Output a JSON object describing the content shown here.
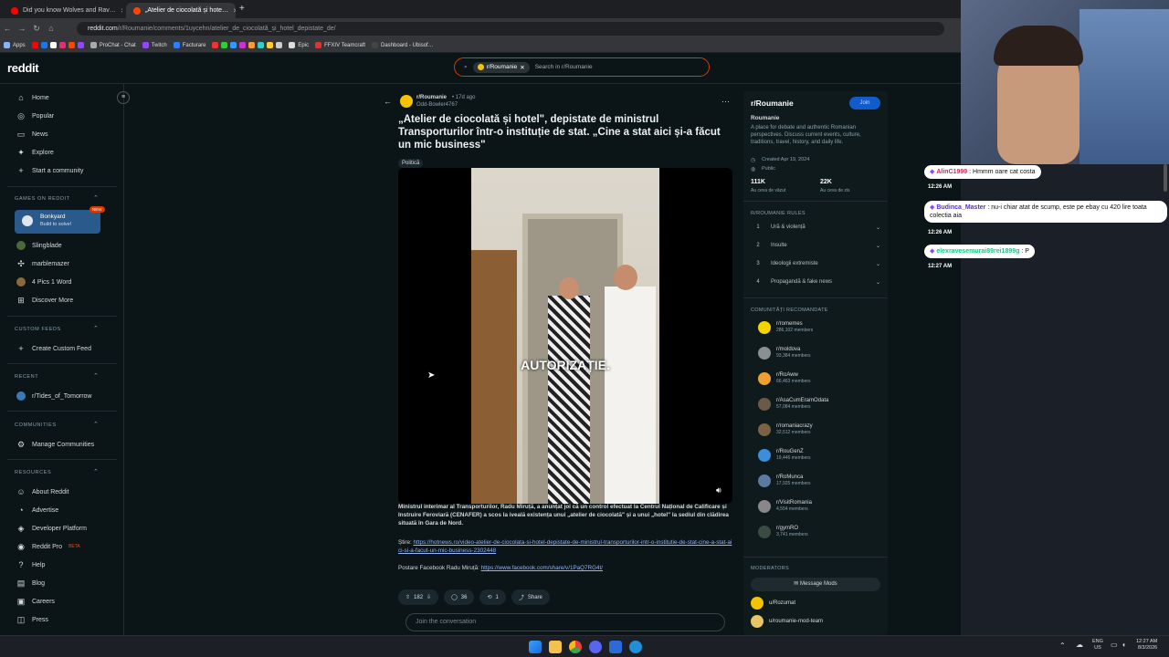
{
  "browser": {
    "tabs": [
      {
        "title": "Did you know Wolves and Rav…",
        "favicon_color": "#ff0000"
      },
      {
        "title": "„Atelier de ciocolată și hote…",
        "favicon_color": "#ff4500"
      }
    ],
    "url_host": "reddit.com",
    "url_path": "/r/Roumanie/comments/1uycehn/atelier_de_ciocolată_și_hotel_depistate_de/",
    "bookmarks": [
      "Apps",
      "ProChat - Chat",
      "Twitch",
      "Facturare",
      "Epic",
      "FFXIV Teamcraft",
      "Dashboard - Ubisof…"
    ]
  },
  "reddit": {
    "logo": "reddit",
    "search": {
      "chip": "r/Roumanie",
      "placeholder": "Search in r/Roumanie"
    }
  },
  "leftnav": {
    "main": [
      "Home",
      "Popular",
      "News",
      "Explore",
      "Start a community"
    ],
    "games_title": "GAMES ON REDDIT",
    "bonkyard": {
      "name": "Bonkyard",
      "sub": "Build to solve!",
      "badge": "NEW"
    },
    "games": [
      "Slingblade",
      "marblemazer",
      "4 Pics 1 Word",
      "Discover More"
    ],
    "custom_title": "CUSTOM FEEDS",
    "custom": [
      "Create Custom Feed"
    ],
    "recent_title": "RECENT",
    "recent": [
      "r/Tides_of_Tomorrow"
    ],
    "communities_title": "COMMUNITIES",
    "communities": [
      "Manage Communities"
    ],
    "resources_title": "RESOURCES",
    "resources": [
      "About Reddit",
      "Advertise",
      "Developer Platform",
      "Reddit Pro",
      "Help",
      "Blog",
      "Careers",
      "Press"
    ],
    "beta": "BETA"
  },
  "post": {
    "subreddit": "r/Roumanie",
    "age": "• 17d ago",
    "author": "Odd-Bowler4767",
    "title": "„Atelier de ciocolată și hotel\", depistate de ministrul Transporturilor într-o instituție de stat. „Cine a stat aici și-a făcut un mic business\"",
    "flair": "Politică",
    "video_caption": "AUTORIZAȚIE.",
    "body": "Ministrul interimar al Transporturilor, Radu Miruță, a anunțat joi că un control efectuat la Centrul Național de Calificare și Instruire Feroviară (CENAFER) a scos la iveală existența unui „atelier de ciocolată\" și a unui „hotel\" la sediul din clădirea situată în Gara de Nord.",
    "stire_label": "Știre:",
    "stire_link": "https://hotnews.ro/video-atelier-de-ciocolata-si-hotel-depistate-de-ministrul-transporturilor-intr-o-institutie-de-stat-cine-a-stat-aici-si-a-facut-un-mic-business-2302448",
    "fb_label": "Postare Facebook Radu Miruță:",
    "fb_link": "https://www.facebook.com/share/v/1PaQ7RG4t/",
    "votes": "182",
    "comments": "36",
    "crossposts": "1",
    "share": "Share",
    "join_placeholder": "Join the conversation"
  },
  "rside": {
    "name": "r/Roumanie",
    "join": "Join",
    "subtitle": "Roumanie",
    "desc": "A place for debate and authentic Romanian perspectives. Discuss current events, culture, traditions, travel, history, and daily life.",
    "created": "Created Apr 19, 2024",
    "visibility": "Public",
    "weekly_visitors": "111K",
    "weekly_visitors_label": "Au ceva de văzut",
    "weekly_contrib": "22K",
    "weekly_contrib_label": "Au ceva de zis",
    "rules_title": "R/ROUMANIE RULES",
    "rules": [
      {
        "n": "1",
        "t": "Ură & violență"
      },
      {
        "n": "2",
        "t": "Insulte"
      },
      {
        "n": "3",
        "t": "Ideologii extremiste"
      },
      {
        "n": "4",
        "t": "Propagandă & fake news"
      }
    ],
    "recommended_title": "COMUNITĂȚI RECOMANDATE",
    "recommended": [
      {
        "name": "r/romemes",
        "members": "286,102 members",
        "color": "#f5d400"
      },
      {
        "name": "r/moldova",
        "members": "93,384 members",
        "color": "#8a8f94"
      },
      {
        "name": "r/RoAww",
        "members": "66,463 members",
        "color": "#f0a030"
      },
      {
        "name": "r/AsaCumEramOdata",
        "members": "57,084 members",
        "color": "#6b5a48"
      },
      {
        "name": "r/romaniacrazy",
        "members": "32,512 members",
        "color": "#7a6242"
      },
      {
        "name": "r/RouGenZ",
        "members": "19,446 members",
        "color": "#3a8fd8"
      },
      {
        "name": "r/RoMunca",
        "members": "17,925 members",
        "color": "#5a7aa0"
      },
      {
        "name": "r/VisitRomania",
        "members": "4,554 members",
        "color": "#888"
      },
      {
        "name": "r/gymRO",
        "members": "3,741 members",
        "color": "#3a4a44"
      }
    ],
    "moderators_title": "MODERATORS",
    "message_mods": "Message Mods",
    "mods": [
      "u/Rozumat",
      "u/roumanie-mod-team"
    ]
  },
  "stream": {
    "chat": [
      {
        "user": "AlinC1999",
        "text": "Hmmm oare cat costa",
        "time": "12:26 AM",
        "user_color": "#e0245e"
      },
      {
        "user": "Budinca_Master",
        "text": "nu-i chiar atat de scump, este pe ebay cu 420 lire toata colectia aia",
        "time": "12:26 AM",
        "user_color": "#5a2bd8"
      },
      {
        "user": "elexravesemurai89rei1899g",
        "text": "P",
        "time": "12:27 AM",
        "user_color": "#16c784"
      }
    ]
  },
  "taskbar": {
    "lang": "ENG",
    "region": "US",
    "time": "12:27 AM",
    "date": "8/3/2026"
  }
}
